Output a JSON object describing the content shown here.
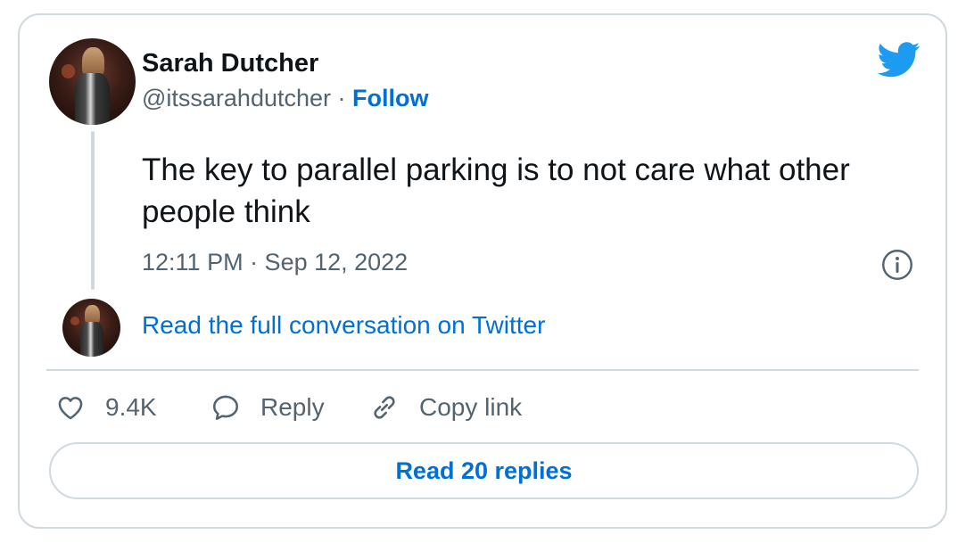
{
  "author": {
    "name": "Sarah Dutcher",
    "handle": "@itssarahdutcher",
    "separator": "·",
    "follow_label": "Follow"
  },
  "tweet": {
    "text": "The key to parallel parking is to not care what other people think",
    "timestamp": "12:11 PM · Sep 12, 2022"
  },
  "conversation": {
    "read_full_label": "Read the full conversation on Twitter"
  },
  "actions": {
    "like_count": "9.4K",
    "reply_label": "Reply",
    "copy_link_label": "Copy link"
  },
  "replies_button": {
    "label": "Read 20 replies"
  },
  "icons": {
    "brand": "twitter-bird-icon",
    "info": "info-icon",
    "like": "heart-icon",
    "reply": "speech-bubble-icon",
    "copy": "link-icon"
  },
  "colors": {
    "link_blue": "#006fd6",
    "twitter_blue": "#1d9bf0",
    "text_primary": "#0f1419",
    "text_secondary": "#536471",
    "border": "#cfd9de"
  }
}
